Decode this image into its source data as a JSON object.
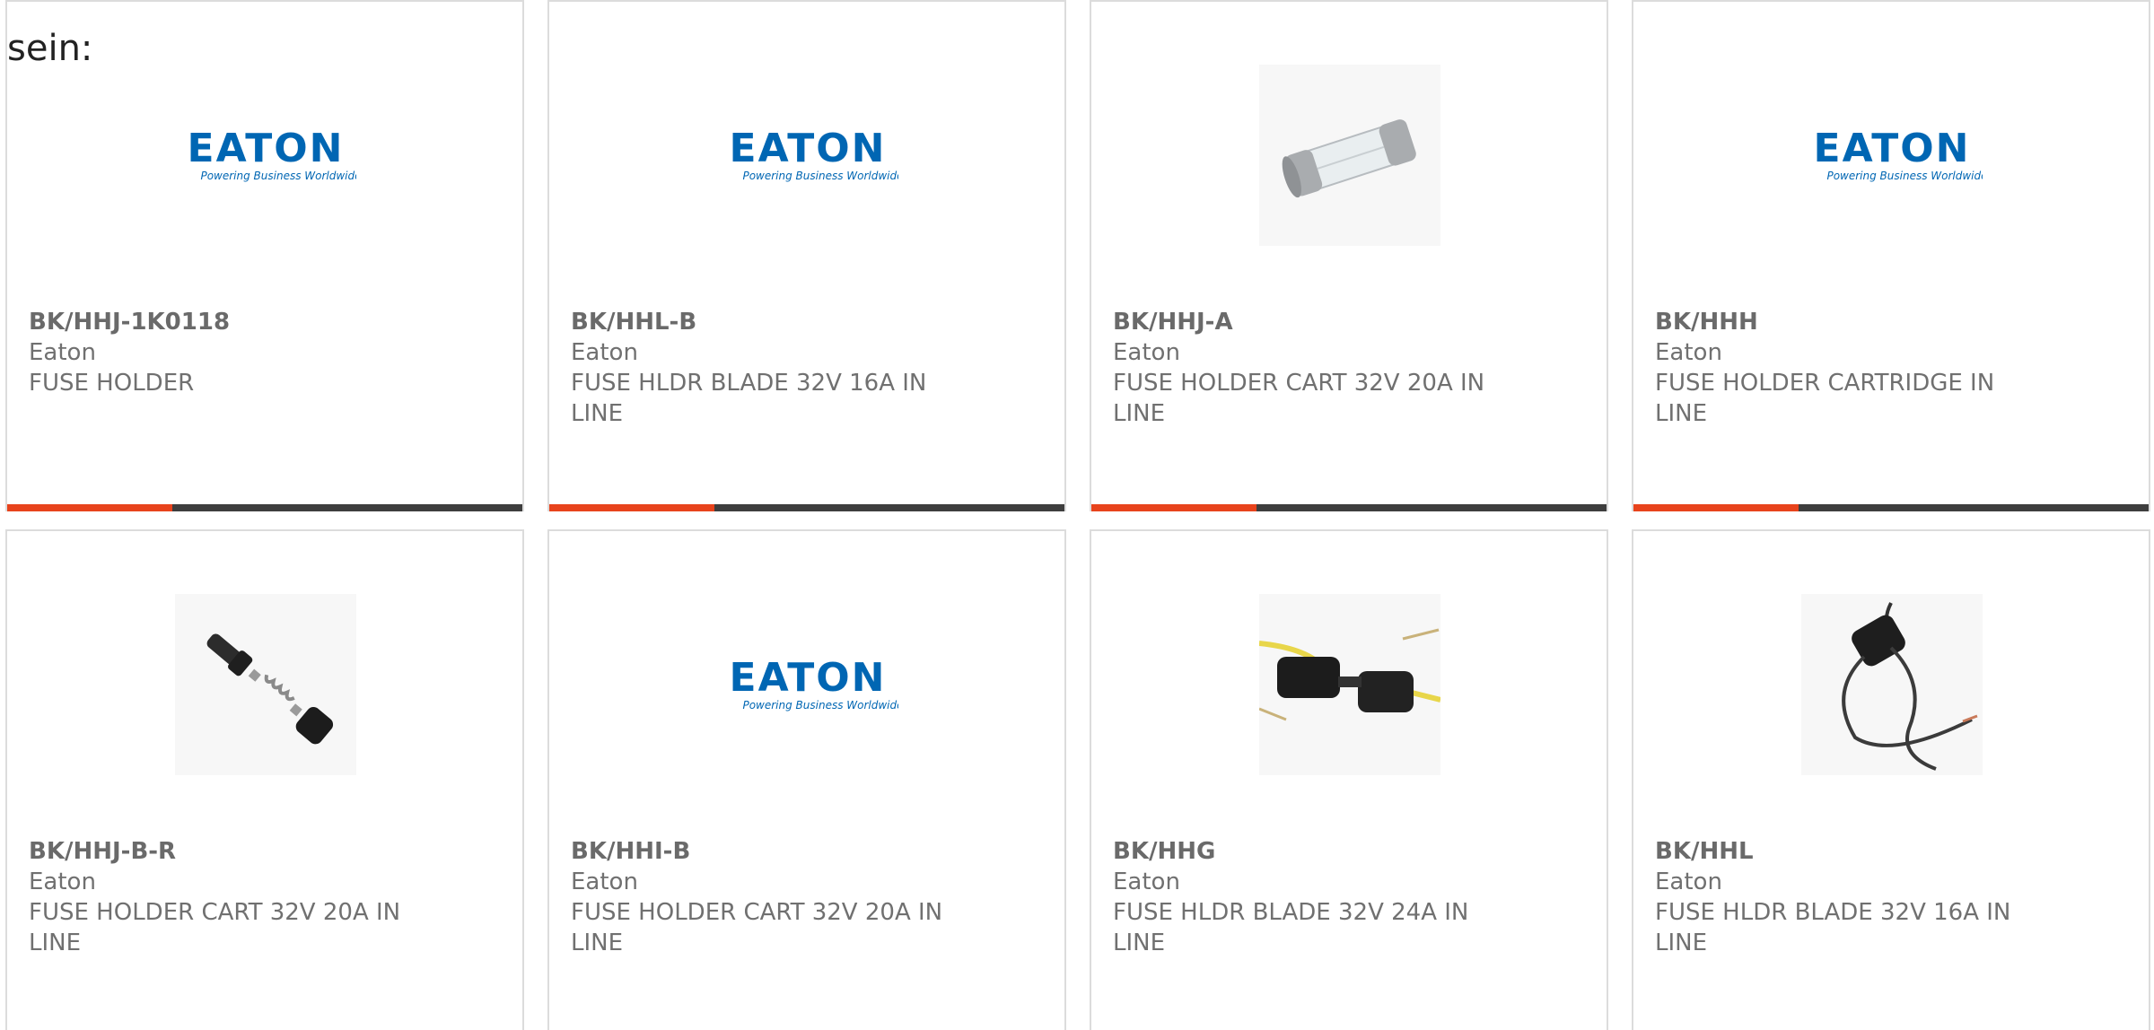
{
  "intro_text": "sein:",
  "colors": {
    "accent": "#e8431c",
    "bar": "#3e3e3e",
    "eaton_blue": "#0066b3",
    "text": "#707070"
  },
  "accent_fraction": 0.32,
  "brand": {
    "logo_word": "EATON",
    "logo_tagline": "Powering Business Worldwide"
  },
  "products": [
    {
      "part_number": "BK/HHJ-1K0118",
      "manufacturer": "Eaton",
      "description": "FUSE HOLDER",
      "image": "eaton-logo"
    },
    {
      "part_number": "BK/HHL-B",
      "manufacturer": "Eaton",
      "description": "FUSE HLDR BLADE 32V 16A IN LINE",
      "image": "eaton-logo"
    },
    {
      "part_number": "BK/HHJ-A",
      "manufacturer": "Eaton",
      "description": "FUSE HOLDER CART 32V 20A IN LINE",
      "image": "cartridge-fuse-photo"
    },
    {
      "part_number": "BK/HHH",
      "manufacturer": "Eaton",
      "description": "FUSE HOLDER CARTRIDGE IN LINE",
      "image": "eaton-logo"
    },
    {
      "part_number": "BK/HHJ-B-R",
      "manufacturer": "Eaton",
      "description": "FUSE HOLDER CART 32V 20A IN LINE",
      "image": "fuse-holder-parts-photo"
    },
    {
      "part_number": "BK/HHI-B",
      "manufacturer": "Eaton",
      "description": "FUSE HOLDER CART 32V 20A IN LINE",
      "image": "eaton-logo"
    },
    {
      "part_number": "BK/HHG",
      "manufacturer": "Eaton",
      "description": "FUSE HLDR BLADE 32V 24A IN LINE",
      "image": "blade-fuse-holder-photo"
    },
    {
      "part_number": "BK/HHL",
      "manufacturer": "Eaton",
      "description": "FUSE HLDR BLADE 32V 16A IN LINE",
      "image": "wired-fuse-holder-photo"
    }
  ]
}
